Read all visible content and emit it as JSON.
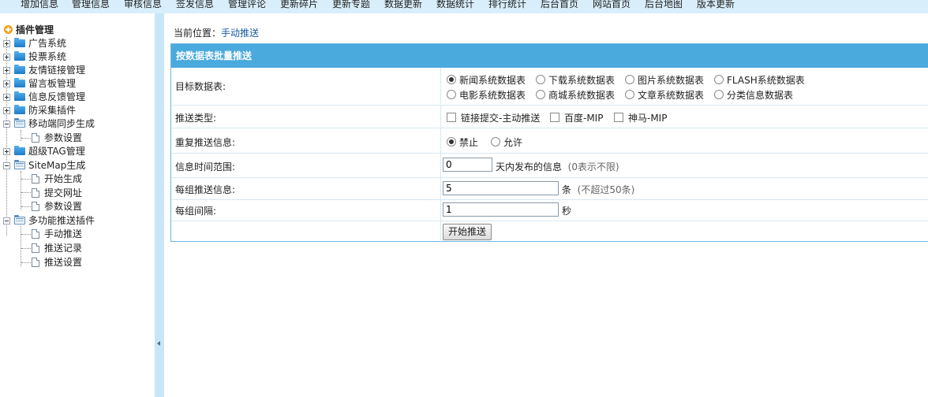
{
  "topnav": {
    "items": [
      "增加信息",
      "管理信息",
      "审核信息",
      "签发信息",
      "管理评论",
      "更新碎片",
      "更新专题",
      "数据更新",
      "数据统计",
      "排行统计",
      "后台首页",
      "网站首页",
      "后台地图",
      "版本更新"
    ]
  },
  "sidebar": {
    "root_label": "插件管理",
    "nodes": {
      "ad": "广告系统",
      "vote": "投票系统",
      "links": "友情链接管理",
      "board": "留言板管理",
      "feedback": "信息反馈管理",
      "anticollect": "防采集插件",
      "mobile": "移动端同步生成",
      "mobile_params": "参数设置",
      "tag": "超级TAG管理",
      "sitemap": "SiteMap生成",
      "sitemap_start": "开始生成",
      "sitemap_submit": "提交网址",
      "sitemap_params": "参数设置",
      "push": "多功能推送插件",
      "push_manual": "手动推送",
      "push_log": "推送记录",
      "push_settings": "推送设置"
    }
  },
  "main": {
    "breadcrumb_prefix": "当前位置：",
    "breadcrumb_link": "手动推送",
    "panel_title": "按数据表批量推送",
    "rows": {
      "target_label": "目标数据表:",
      "tables": [
        "新闻系统数据表",
        "下载系统数据表",
        "图片系统数据表",
        "FLASH系统数据表",
        "电影系统数据表",
        "商城系统数据表",
        "文章系统数据表",
        "分类信息数据表"
      ],
      "push_type_label": "推送类型:",
      "push_types": [
        "链接提交-主动推送",
        "百度-MIP",
        "神马-MIP"
      ],
      "repeat_label": "重复推送信息:",
      "repeat_opts": [
        "禁止",
        "允许"
      ],
      "time_label": "信息时间范围:",
      "time_value": "0",
      "time_after": "天内发布的信息",
      "time_hint": "(0表示不限)",
      "group_label": "每组推送信息:",
      "group_value": "5",
      "group_after": "条",
      "group_hint": "(不超过50条)",
      "interval_label": "每组间隔:",
      "interval_value": "1",
      "interval_after": "秒",
      "start_button": "开始推送"
    }
  }
}
